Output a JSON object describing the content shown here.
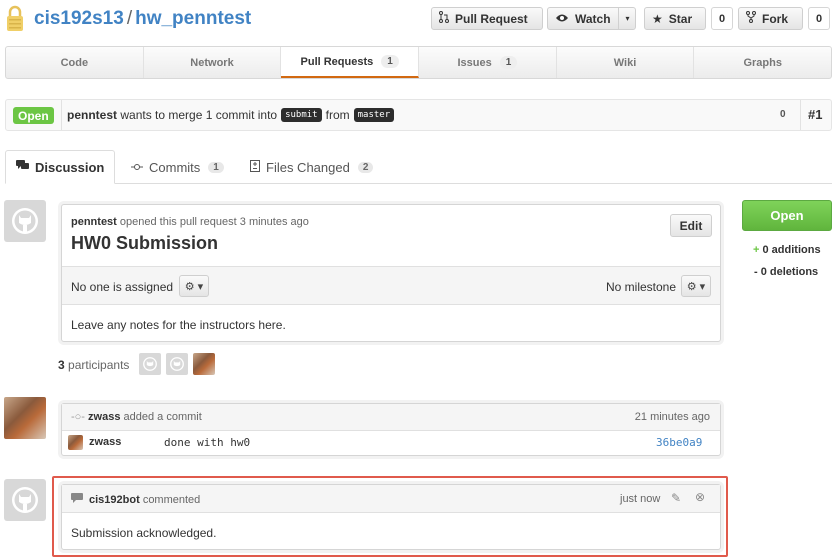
{
  "header": {
    "owner": "cis192s13",
    "separator": "/",
    "repo": "hw_penntest",
    "pull_request_label": "Pull Request",
    "watch_label": "Watch",
    "watch_count": "0",
    "star_label": "Star",
    "star_count": "0",
    "fork_label": "Fork",
    "fork_count": "0"
  },
  "nav": {
    "tabs": [
      {
        "label": "Code"
      },
      {
        "label": "Network"
      },
      {
        "label": "Pull Requests",
        "count": "1"
      },
      {
        "label": "Issues",
        "count": "1"
      },
      {
        "label": "Wiki"
      },
      {
        "label": "Graphs"
      }
    ]
  },
  "pr_state": {
    "state": "Open",
    "author": "penntest",
    "text_merge": "wants to merge 1 commit into",
    "base_branch": "submit",
    "text_from": "from",
    "head_branch": "master",
    "comment_count": "0",
    "number": "#1"
  },
  "discussion_tabs": [
    {
      "label": "Discussion"
    },
    {
      "label": "Commits",
      "count": "1"
    },
    {
      "label": "Files Changed",
      "count": "2"
    }
  ],
  "pr": {
    "author": "penntest",
    "opened_text": "opened this pull request 3 minutes ago",
    "title": "HW0 Submission",
    "edit_label": "Edit",
    "assignee_text": "No one is assigned",
    "milestone_text": "No milestone",
    "body": "Leave any notes for the instructors here."
  },
  "participants": {
    "count": "3",
    "label": "participants"
  },
  "sidebar": {
    "button_label": "Open",
    "additions": "+ 0 additions",
    "additions_sign": "+",
    "additions_text": "0 additions",
    "deletions": "- 0 deletions"
  },
  "commit": {
    "user": "zwass",
    "action": "added a commit",
    "time": "21 minutes ago",
    "row_user": "zwass",
    "message": "done with hw0",
    "sha": "36be0a9"
  },
  "comment": {
    "user": "cis192bot",
    "action": "commented",
    "time": "just now",
    "body": "Submission acknowledged."
  },
  "colors": {
    "link": "#4183c4",
    "open_green": "#6cc644",
    "highlight_red": "#e05a4c",
    "nav_active_border": "#d26911"
  }
}
